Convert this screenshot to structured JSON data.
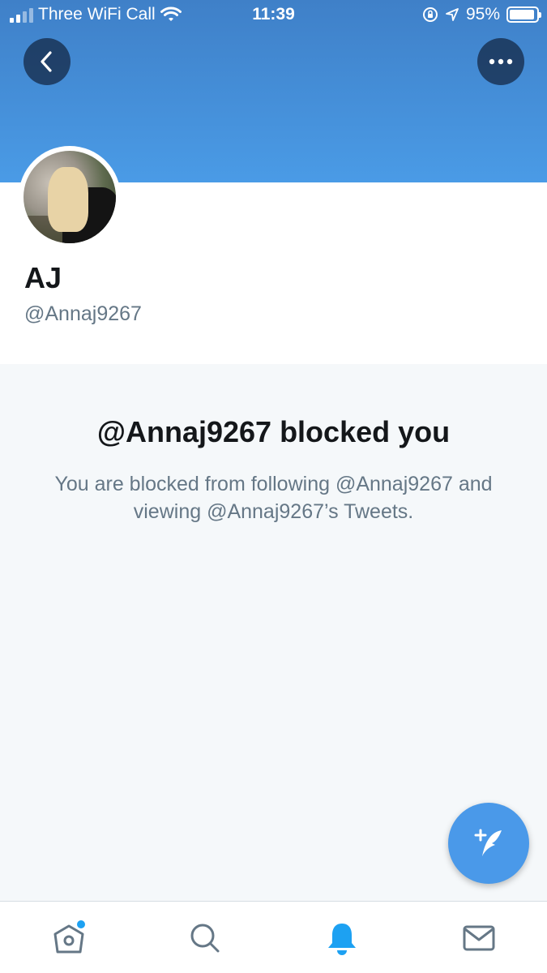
{
  "status_bar": {
    "carrier": "Three WiFi Call",
    "time": "11:39",
    "battery": "95%",
    "battery_level": 0.95
  },
  "header": {
    "back_icon": "chevron-left-icon",
    "more_icon": "more-dots-icon"
  },
  "profile": {
    "name": "AJ",
    "handle": "@Annaj9267"
  },
  "blocked": {
    "title": "@Annaj9267 blocked you",
    "message": "You are blocked from following @Annaj9267 and viewing @Annaj9267’s Tweets."
  },
  "fab": {
    "icon": "compose-tweet-icon"
  },
  "tab_bar": {
    "items": [
      {
        "icon": "home-icon",
        "has_badge": true
      },
      {
        "icon": "search-icon"
      },
      {
        "icon": "notifications-bell-icon",
        "active": true
      },
      {
        "icon": "messages-envelope-icon"
      }
    ]
  },
  "colors": {
    "accent": "#1da1f2",
    "banner": "#4a9be6",
    "text_primary": "#14171a",
    "text_secondary": "#657786",
    "background_gray": "#f5f8fa"
  }
}
